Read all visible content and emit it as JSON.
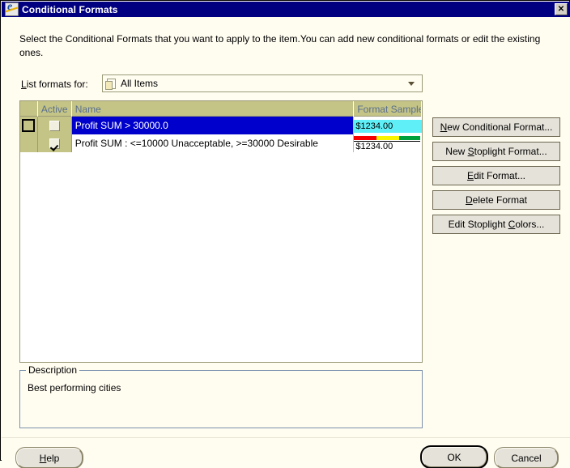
{
  "window": {
    "title": "Conditional Formats",
    "icon": "ie-document-icon",
    "close_label": "✕"
  },
  "instruction": "Select the Conditional Formats that you want to apply to the item.You can add new conditional formats or edit the existing ones.",
  "filter": {
    "label_prefix": "L",
    "label_rest": "ist formats for:",
    "icon": "document-icon",
    "selected": "All Items",
    "options": [
      "All Items"
    ]
  },
  "table": {
    "columns": [
      "",
      "Active",
      "Name",
      "Format Sample"
    ],
    "rows": [
      {
        "selector_focused": true,
        "active": false,
        "name": "Profit SUM > 30000.0",
        "selected": true,
        "sample_text": "$1234.00",
        "sample_style": "cyan-fill",
        "sample_bg": "#5FF0F7"
      },
      {
        "selector_focused": false,
        "active": true,
        "name": "Profit SUM : <=10000 Unacceptable, >=30000 Desirable",
        "selected": false,
        "sample_text": "$1234.00",
        "sample_style": "stoplight-bar",
        "stoplight_colors": [
          "#F70000",
          "#FBF400",
          "#00A13C"
        ]
      }
    ]
  },
  "side_buttons": [
    {
      "accel": "N",
      "rest": "ew Conditional Format...",
      "pre": ""
    },
    {
      "accel": "S",
      "rest": "toplight Format...",
      "pre": "New "
    },
    {
      "accel": "E",
      "rest": "dit Format...",
      "pre": ""
    },
    {
      "accel": "D",
      "rest": "elete Format",
      "pre": ""
    },
    {
      "accel": "C",
      "rest": "olors...",
      "pre": "Edit Stoplight "
    }
  ],
  "description": {
    "title": "Description",
    "text": "Best performing cities"
  },
  "footer": {
    "help_accel": "H",
    "help_rest": "elp",
    "ok": "OK",
    "cancel": "Cancel"
  },
  "colors": {
    "titlebar": "#000080",
    "dialog_bg": "#FFFCF0",
    "header_olive": "#C4C486",
    "selection_blue": "#0000CC",
    "group_border": "#7C91AD"
  }
}
